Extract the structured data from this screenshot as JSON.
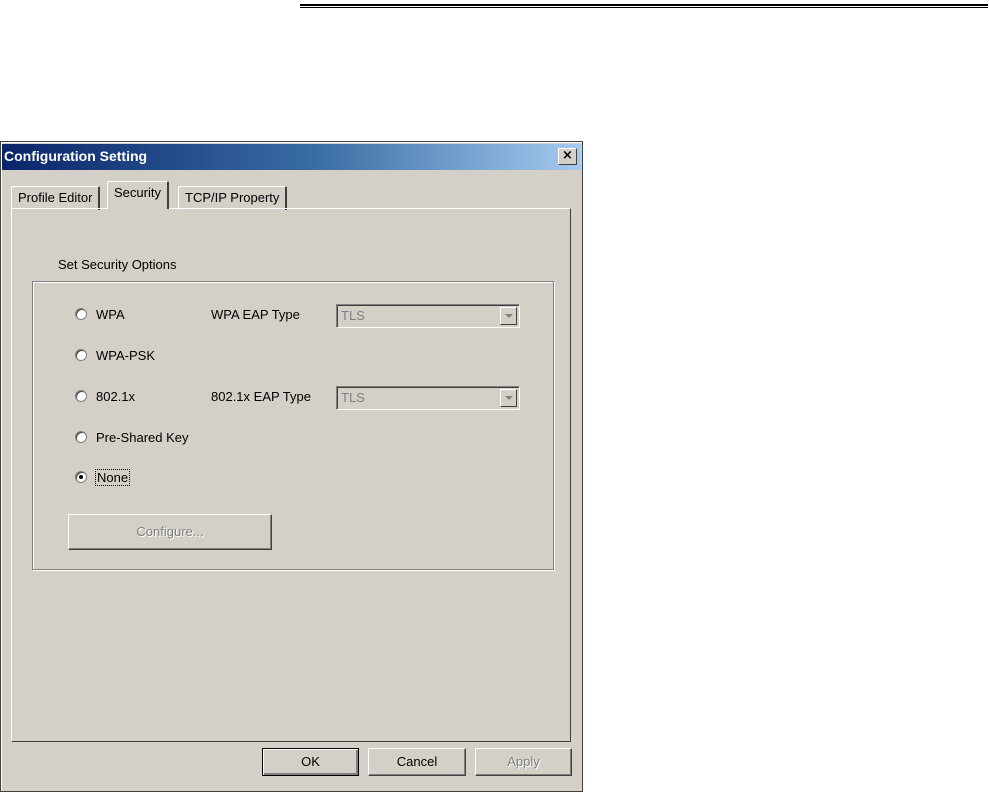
{
  "window": {
    "title": "Configuration Setting",
    "close_label": "×"
  },
  "tabs": [
    {
      "label": "Profile Editor",
      "active": false
    },
    {
      "label": "Security",
      "active": true
    },
    {
      "label": "TCP/IP Property",
      "active": false
    }
  ],
  "security": {
    "group_label": "Set Security Options",
    "options": [
      {
        "label": "WPA",
        "checked": false
      },
      {
        "label": "WPA-PSK",
        "checked": false
      },
      {
        "label": "802.1x",
        "checked": false
      },
      {
        "label": "Pre-Shared Key",
        "checked": false
      },
      {
        "label": "None",
        "checked": true
      }
    ],
    "wpa_eap_label": "WPA EAP Type",
    "wpa_eap_value": "TLS",
    "dot1x_eap_label": "802.1x EAP Type",
    "dot1x_eap_value": "TLS",
    "configure_label": "Configure..."
  },
  "footer": {
    "ok_label": "OK",
    "cancel_label": "Cancel",
    "apply_label": "Apply"
  },
  "icons": {
    "close": "close-icon",
    "dropdown": "chevron-down-icon"
  }
}
